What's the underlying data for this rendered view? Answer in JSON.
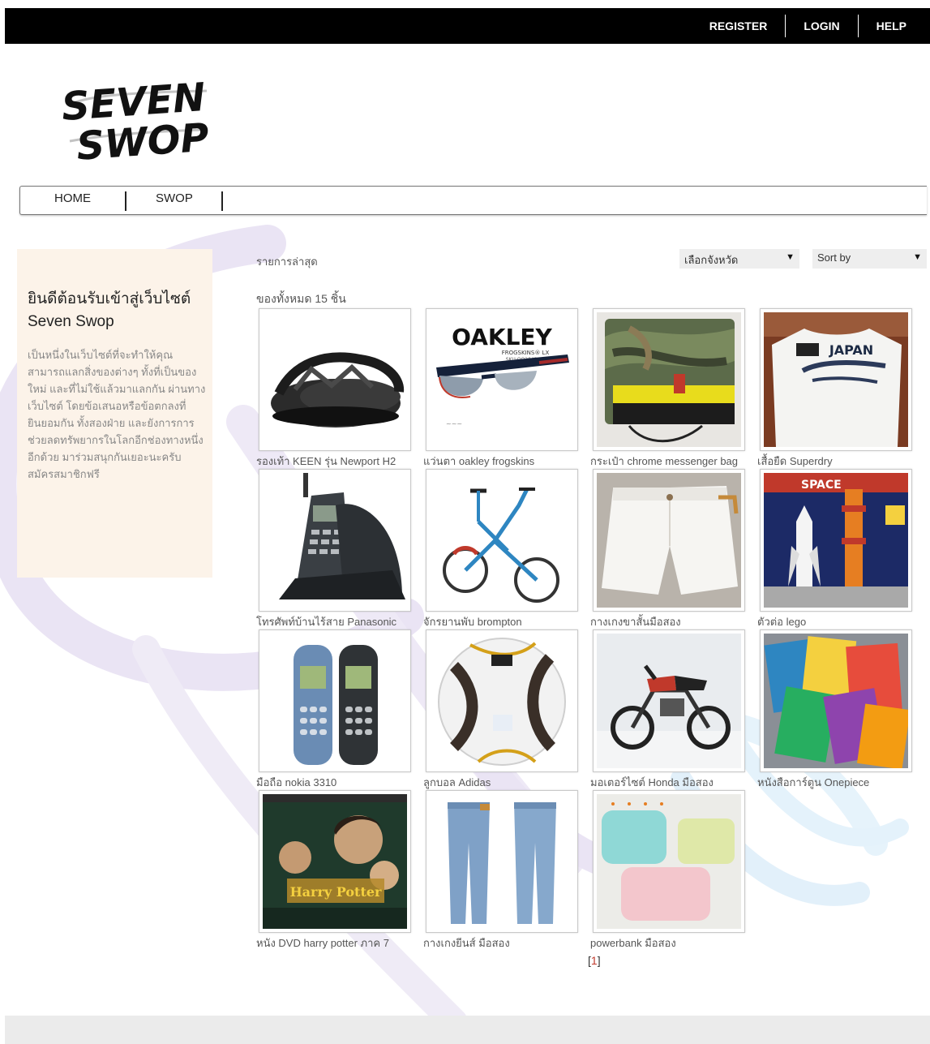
{
  "topnav": {
    "register": "REGISTER",
    "login": "LOGIN",
    "help": "HELP"
  },
  "mainnav": {
    "home": "HOME",
    "swop": "SWOP"
  },
  "sidebar": {
    "title": "ยินดีต้อนรับเข้าสู่เว็บไซต์ Seven Swop",
    "text": "เป็นหนึ่งในเว็บไซต์ที่จะทำให้คุณ สามารถแลกสิ่งของต่างๆ ทั้งที่เป็นของใหม่ และที่ไม่ใช้แล้วมาแลกกัน ผ่านทางเว็บไซต์ โดยข้อเสนอหรือข้อตกลงที่ยินยอมกัน ทั้งสองฝ่าย และยังการการช่วยลดทรัพยากรในโลกอีกช่องทางหนึ่งอีกด้วย มาร่วมสนุกกันเยอะนะครับ สมัครสมาชิกฟรี"
  },
  "listing": {
    "heading": "รายการล่าสุด",
    "count": "ของทั้งหมด 15 ชิ้น",
    "province_select": "เลือกจังหวัด",
    "sort_select": "Sort by"
  },
  "items": [
    {
      "name": "รองเท้า KEEN รุ่น Newport H2",
      "icon": "sandal-photo"
    },
    {
      "name": "แว่นตา oakley frogskins",
      "icon": "sunglasses-photo",
      "brand": "OAKLEY",
      "model": "FROGSKINS® LX",
      "sku": "SKU:OO2043-05"
    },
    {
      "name": "กระเป๋า chrome messenger bag",
      "icon": "bag-photo"
    },
    {
      "name": "เสื้อยืด Superdry",
      "icon": "tshirt-photo",
      "print": "JAPAN"
    },
    {
      "name": "โทรศัพท์บ้านไร้สาย Panasonic",
      "icon": "phone-photo"
    },
    {
      "name": "จักรยานพับ brompton",
      "icon": "bicycle-photo"
    },
    {
      "name": "กางเกงขาสั้นมือสอง",
      "icon": "shorts-photo"
    },
    {
      "name": "ตัวต่อ lego",
      "icon": "lego-photo",
      "print": "SPACE"
    },
    {
      "name": "มือถือ nokia 3310",
      "icon": "nokia-photo"
    },
    {
      "name": "ลูกบอล Adidas",
      "icon": "ball-photo"
    },
    {
      "name": "มอเตอร์ไซต์ Honda มือสอง",
      "icon": "motorcycle-photo"
    },
    {
      "name": "หนังสือการ์ตูน Onepiece",
      "icon": "comic-photo"
    },
    {
      "name": "หนัง DVD harry potter ภาค 7",
      "icon": "dvd-photo",
      "print": "Harry Potter"
    },
    {
      "name": "กางเกงยีนส์ มือสอง",
      "icon": "jeans-photo"
    },
    {
      "name": "powerbank มือสอง",
      "icon": "powerbank-photo"
    }
  ],
  "pager": {
    "open": "[",
    "current": "1",
    "close": "]"
  }
}
